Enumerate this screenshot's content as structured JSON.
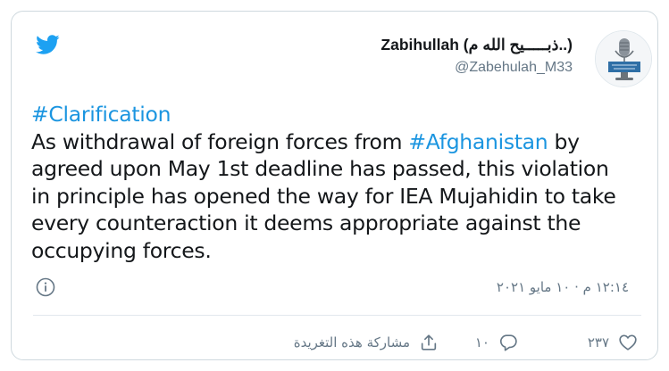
{
  "tweet": {
    "display_name": "Zabihullah (ذبـــــیح الله م..)",
    "handle": "@Zabehulah_M33",
    "text_lines": [
      [
        {
          "t": "#Clarification",
          "tag": true
        }
      ],
      [
        {
          "t": "As withdrawal of foreign forces from ",
          "tag": false
        },
        {
          "t": "#Afghanistan",
          "tag": true
        },
        {
          "t": " by",
          "tag": false
        }
      ],
      [
        {
          "t": "agreed upon May 1st deadline has passed, this violation",
          "tag": false
        }
      ],
      [
        {
          "t": "in principle has opened the way for IEA Mujahidin to take",
          "tag": false
        }
      ],
      [
        {
          "t": "every counteraction it deems appropriate against the",
          "tag": false
        }
      ],
      [
        {
          "t": "occupying forces.",
          "tag": false
        }
      ]
    ],
    "timestamp": "١٢:١٤ م · ١٠ مايو ٢٠٢١"
  },
  "actions": {
    "like_count": "٢٣٧",
    "reply_count": "١٠",
    "share_label": "مشاركة هذه التغريدة"
  },
  "icons": {
    "logo": "twitter-bird-icon",
    "info": "info-icon",
    "like": "heart-icon",
    "reply": "reply-bubble-icon",
    "share": "share-upload-icon"
  },
  "colors": {
    "brand": "#1da1f2",
    "hashtag": "#1b95e0",
    "text": "#14171a",
    "muted": "#657786",
    "border": "#cfd9de"
  }
}
